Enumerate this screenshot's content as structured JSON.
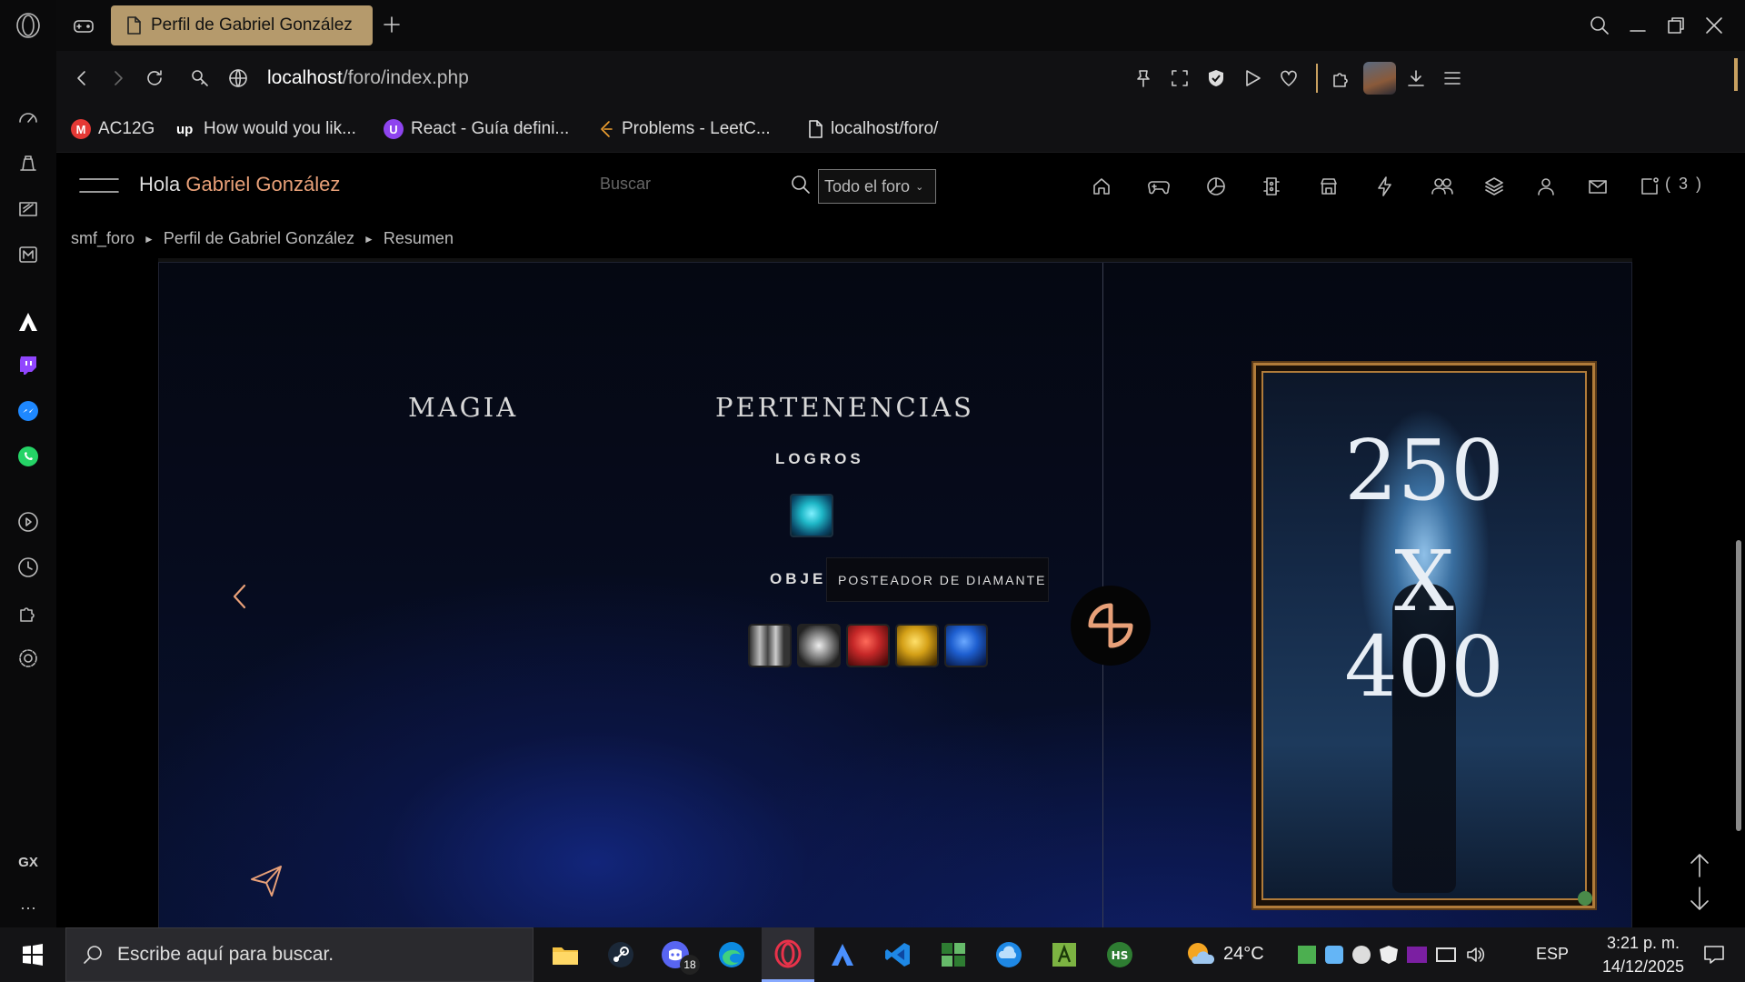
{
  "sidebar": {
    "items": [
      "opera-logo",
      "speed-dial-icon",
      "stack-icon",
      "cards-icon",
      "m-app-icon",
      "aria-icon",
      "twitch-icon",
      "messenger-icon",
      "whatsapp-icon",
      "player-icon",
      "history-icon",
      "extensions-icon",
      "settings-icon"
    ],
    "gx_label": "GX",
    "more_label": "···"
  },
  "browser": {
    "tab_title": "Perfil de Gabriel González",
    "url_host": "localhost",
    "url_path": "/foro/index.php",
    "bookmarks": [
      {
        "label": "AC12G",
        "icon_color": "#e53935"
      },
      {
        "label": "How would you lik...",
        "icon_color": "#ffffff"
      },
      {
        "label": "React - Guía defini...",
        "icon_color": "#8e44ef"
      },
      {
        "label": "Problems - LeetC...",
        "icon_color": "#f0a030"
      },
      {
        "label": "localhost/foro/",
        "icon_color": "#cccccc"
      }
    ]
  },
  "forum": {
    "greeting_prefix": "Hola ",
    "user_name": "Gabriel González",
    "search_placeholder": "Buscar",
    "search_scope": "Todo el foro",
    "notification_count": "( 3 )",
    "accent": "#e8a078",
    "breadcrumb": [
      "smf_foro",
      "Perfil de Gabriel González",
      "Resumen"
    ],
    "breadcrumb_sep": "►"
  },
  "profile": {
    "magic_heading": "MAGIA",
    "belongings_heading": "PERTENENCIAS",
    "achievements_label": "LOGROS",
    "objects_label": "OBJETOS",
    "tooltip": "POSTEADOR DE DIAMANTE",
    "achievement_color": "#1fb8c8",
    "items": [
      {
        "icon": "claw-item",
        "color": "#9a9a9a"
      },
      {
        "icon": "scroll-item",
        "color": "#c8c8c8"
      },
      {
        "icon": "red-gem-item",
        "color": "#c62828"
      },
      {
        "icon": "gold-gem-item",
        "color": "#d4a017"
      },
      {
        "icon": "blue-gem-item",
        "color": "#1e5fd0"
      }
    ],
    "poster_line1": "250",
    "poster_line2": "X",
    "poster_line3": "400",
    "poster_frame_color": "#b07b3a"
  },
  "taskbar": {
    "search_placeholder": "Escribe aquí para buscar.",
    "apps": [
      "file-explorer-icon",
      "steam-icon",
      "discord-icon",
      "edge-icon",
      "opera-gx-icon",
      "aria-icon",
      "vscode-icon",
      "app-grid-icon",
      "cloud-app-icon",
      "terminal-app-icon",
      "hs-app-icon"
    ],
    "discord_badge": "18",
    "weather": "24°C",
    "language": "ESP",
    "time": "3:21 p. m.",
    "date": "14/12/2025"
  }
}
